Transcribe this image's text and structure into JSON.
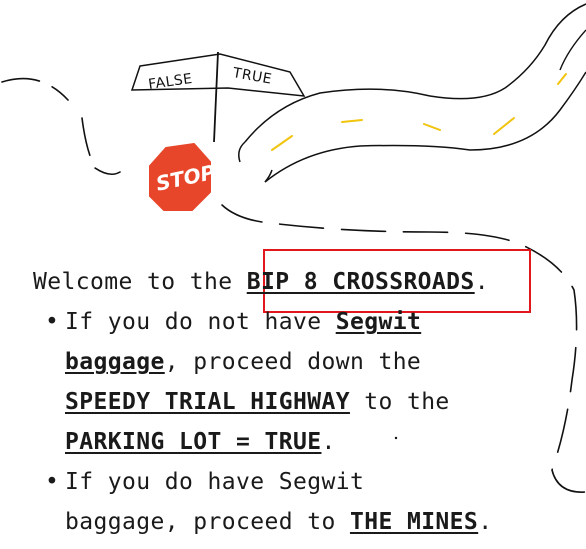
{
  "sketch": {
    "sign_left": "FALSE",
    "sign_right": "TRUE",
    "stop_label": "STOP",
    "stop_color": "#e8462a",
    "road_line_color": "#f1c40f"
  },
  "intro": {
    "before": "Welcome to the ",
    "link": "BIP 8 CROSSROADS",
    "after": "."
  },
  "bullets": [
    {
      "prefix": "If you do not have ",
      "link1": "Segwit",
      "link2": "baggage",
      "middle": ", proceed down the",
      "link3": "SPEEDY TRIAL HIGHWAY",
      "to_the": " to the",
      "link4": "PARKING LOT = TRUE",
      "end": "."
    },
    {
      "line1": "If  you do have Segwit",
      "line2_prefix": "baggage, proceed to ",
      "link": "THE MINES",
      "end": "."
    }
  ],
  "highlight": {
    "color": "#e0171c"
  }
}
